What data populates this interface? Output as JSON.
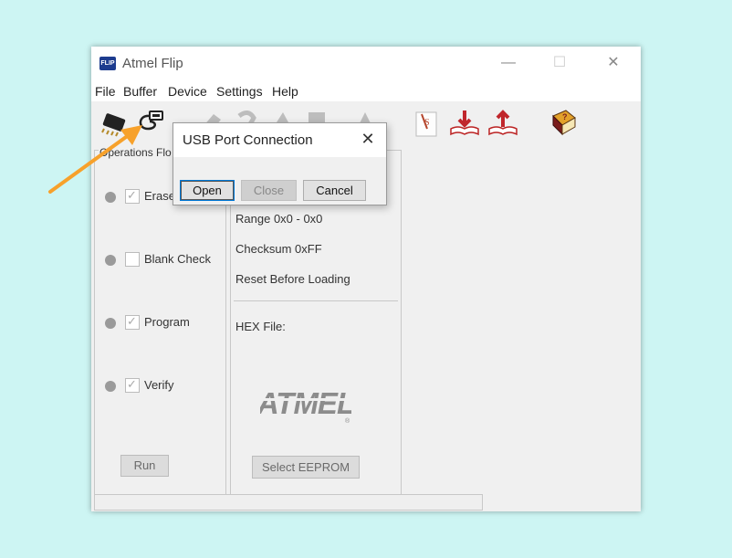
{
  "window": {
    "title": "Atmel Flip",
    "app_icon_text": "FLIP",
    "controls": {
      "minimize": "—",
      "maximize": "☐",
      "close": "✕"
    }
  },
  "menu": [
    "File",
    "Buffer",
    "Device",
    "Settings",
    "Help"
  ],
  "toolbar": {
    "icons": [
      "chip-icon",
      "usb-cable-icon",
      "erase-icon",
      "blank-check-icon",
      "program-icon",
      "verify-icon",
      "read-icon",
      "parse-icon",
      "load-hex-icon",
      "save-buffer-icon",
      "help-book-icon"
    ]
  },
  "operations": {
    "label": "Operations Flo",
    "items": [
      {
        "label": "Erase",
        "checked": true
      },
      {
        "label": "Blank Check",
        "checked": false
      },
      {
        "label": "Program",
        "checked": true
      },
      {
        "label": "Verify",
        "checked": true
      }
    ],
    "run_label": "Run"
  },
  "buffer": {
    "range_label": "Range",
    "range_value": "0x0 - 0x0",
    "checksum_label": "Checksum",
    "checksum_value": "0xFF",
    "reset_label": "Reset Before Loading",
    "hex_file_label": "HEX File:",
    "logo_text": "ATMEL",
    "logo_mark": "®",
    "select_eeprom_label": "Select EEPROM"
  },
  "dialog": {
    "title": "USB Port Connection",
    "close_glyph": "✕",
    "open_label": "Open",
    "close_label": "Close",
    "cancel_label": "Cancel"
  },
  "colors": {
    "background": "#cdf5f3",
    "arrow": "#f7a12b",
    "window": "#f0f0f0"
  }
}
